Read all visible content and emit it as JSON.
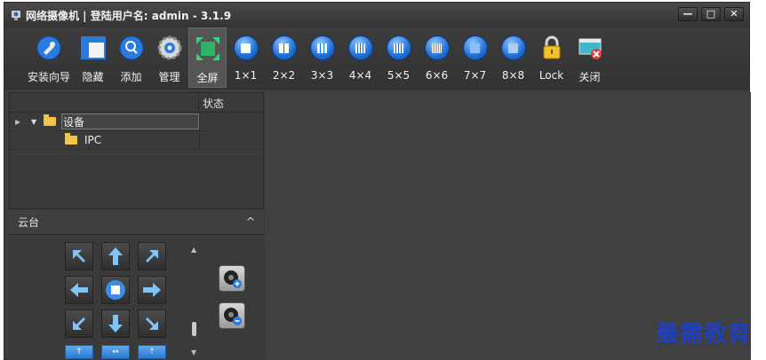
{
  "window": {
    "title": "网络摄像机 | 登陆用户名: admin - 3.1.9",
    "controls": {
      "minimize": "—",
      "maximize": "□",
      "close": "✕"
    }
  },
  "toolbar": {
    "items": [
      {
        "label": "安装向导",
        "icon": "wizard-icon"
      },
      {
        "label": "隐藏",
        "icon": "hide-icon"
      },
      {
        "label": "添加",
        "icon": "add-search-icon"
      },
      {
        "label": "管理",
        "icon": "gear-icon"
      },
      {
        "label": "全屏",
        "icon": "fullscreen-icon"
      },
      {
        "label": "1×1",
        "icon": "grid-1-icon"
      },
      {
        "label": "2×2",
        "icon": "grid-2-icon"
      },
      {
        "label": "3×3",
        "icon": "grid-3-icon"
      },
      {
        "label": "4×4",
        "icon": "grid-4-icon"
      },
      {
        "label": "5×5",
        "icon": "grid-5-icon"
      },
      {
        "label": "6×6",
        "icon": "grid-6-icon"
      },
      {
        "label": "7×7",
        "icon": "grid-7-icon"
      },
      {
        "label": "8×8",
        "icon": "grid-8-icon"
      },
      {
        "label": "Lock",
        "icon": "lock-icon"
      },
      {
        "label": "关闭",
        "icon": "close-screen-icon"
      }
    ],
    "active_index": 4
  },
  "device_tree": {
    "columns": {
      "status": "状态"
    },
    "root": {
      "label": "设备"
    },
    "child": {
      "label": "IPC"
    }
  },
  "ptz": {
    "title": "云台"
  },
  "watermark": "最需教育",
  "colors": {
    "accent_blue": "#1f6fd6",
    "panel_bg": "#3a3a3a",
    "folder": "#f0c74a"
  }
}
